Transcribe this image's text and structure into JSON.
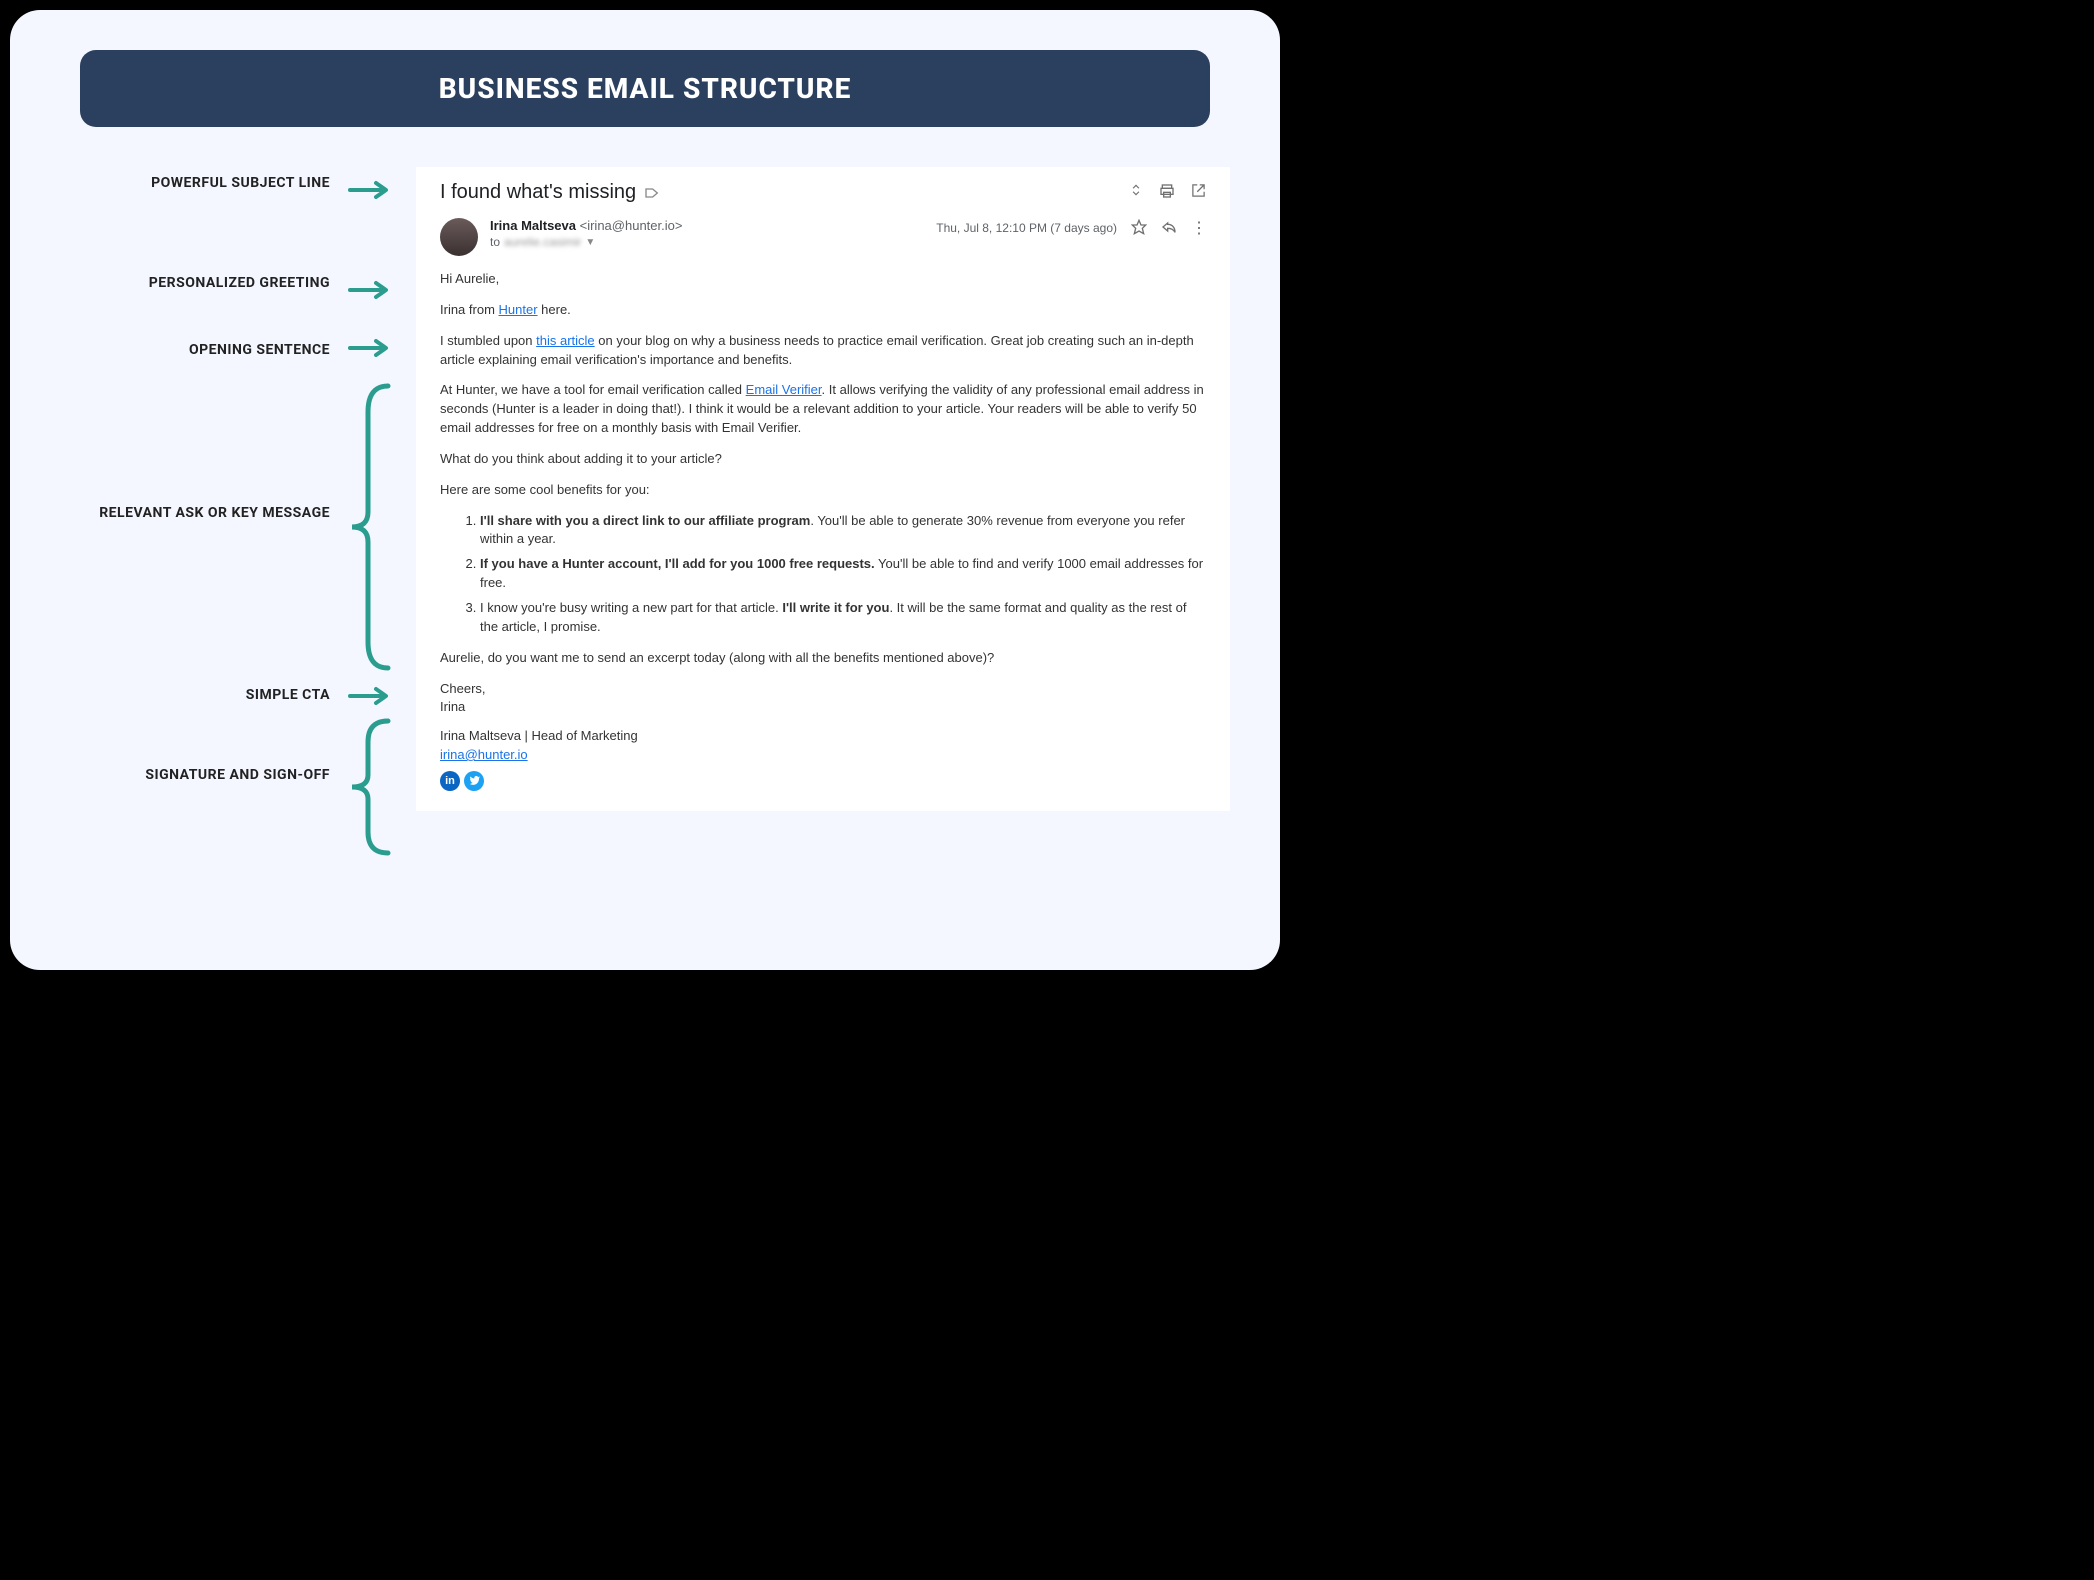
{
  "title": "BUSINESS EMAIL STRUCTURE",
  "labels": {
    "subject": "POWERFUL SUBJECT LINE",
    "greeting": "PERSONALIZED GREETING",
    "opening": "OPENING SENTENCE",
    "ask": "RELEVANT ASK OR KEY MESSAGE",
    "cta": "SIMPLE CTA",
    "signature": "SIGNATURE AND SIGN-OFF"
  },
  "email": {
    "subject": "I found what's missing",
    "sender_name": "Irina Maltseva",
    "sender_email": "<irina@hunter.io>",
    "to_prefix": "to",
    "to_blur": "aurelie.casimir",
    "date": "Thu, Jul 8, 12:10 PM (7 days ago)",
    "greeting": "Hi Aurelie,",
    "intro": "Irina from ",
    "intro_link": "Hunter",
    "intro_tail": " here.",
    "opening_a": "I stumbled upon ",
    "opening_link": "this article",
    "opening_b": " on your blog on why a business needs to practice email verification. Great job creating such an in-depth article explaining email verification's importance and benefits.",
    "ask1_a": "At Hunter, we have a tool for email verification called ",
    "ask1_link": "Email Verifier",
    "ask1_b": ". It allows verifying the validity of any professional email address in seconds (Hunter is a leader in doing that!). I think it would be a relevant addition to your article. Your readers will be able to verify 50 email addresses for free on a monthly basis with Email Verifier.",
    "ask2": "What do you think about adding it to your article?",
    "ask3": "Here are some cool benefits for you:",
    "li1_b": "I'll share with you a direct link to our affiliate program",
    "li1_t": ". You'll be able to generate 30% revenue from everyone you refer within a year.",
    "li2_b": "If you have a Hunter account, I'll add for you 1000 free requests.",
    "li2_t": " You'll be able to find and verify 1000 email addresses for free.",
    "li3_a": "I know you're busy writing a new part for that article. ",
    "li3_b": "I'll write it for you",
    "li3_t": ". It will be the same format and quality as the rest of the article, I promise.",
    "cta": "Aurelie, do you want me to send an excerpt today (along with all the benefits mentioned above)?",
    "signoff1": "Cheers,",
    "signoff2": "Irina",
    "sig_title": "Irina Maltseva | Head of Marketing",
    "sig_email": "irina@hunter.io"
  },
  "colors": {
    "arrow": "#2a9d8f"
  }
}
